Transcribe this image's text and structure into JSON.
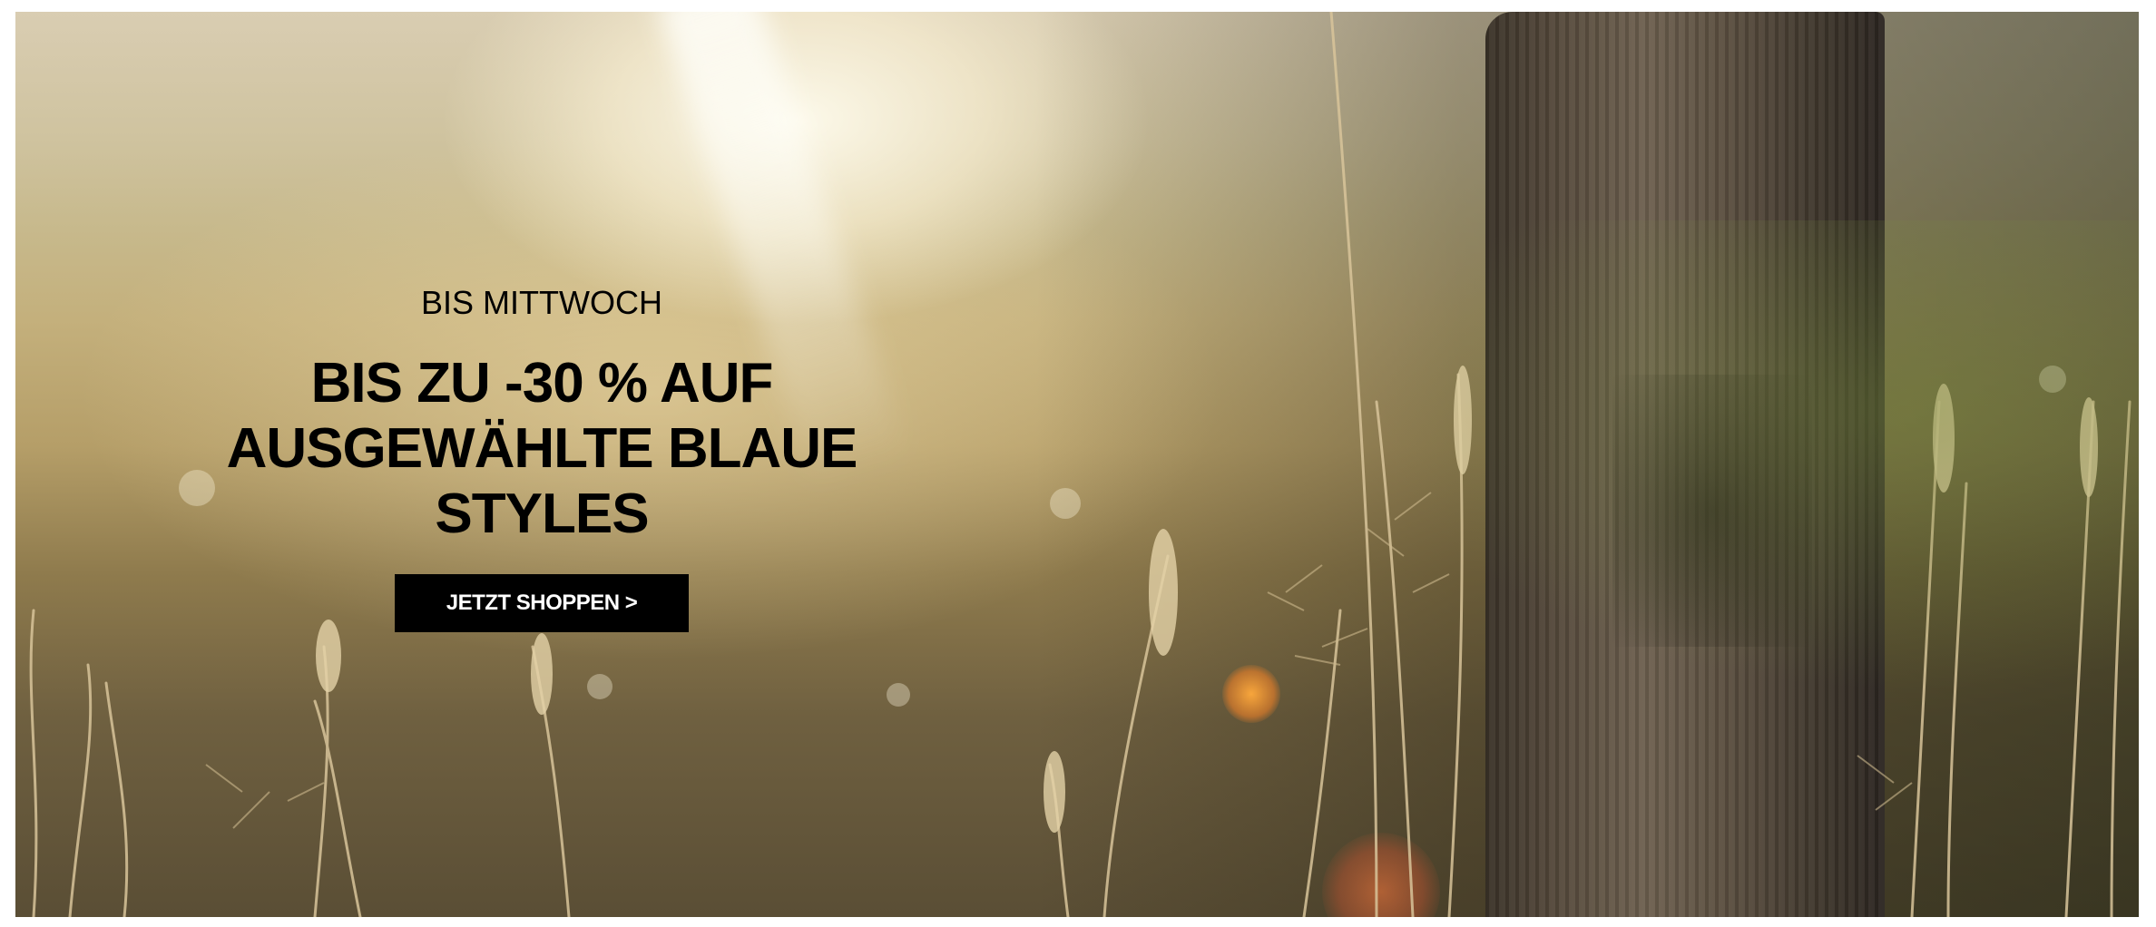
{
  "hero": {
    "eyebrow": "BIS MITTWOCH",
    "headline_line1": "BIS ZU -30 % AUF",
    "headline_line2": "AUSGEWÄHLTE BLAUE",
    "headline_line3": "STYLES",
    "cta_label": "JETZT SHOPPEN >",
    "background_image": "sunlit-meadow-with-tree-trunk"
  },
  "colors": {
    "text": "#000000",
    "cta_background": "#000000",
    "cta_text": "#ffffff"
  }
}
